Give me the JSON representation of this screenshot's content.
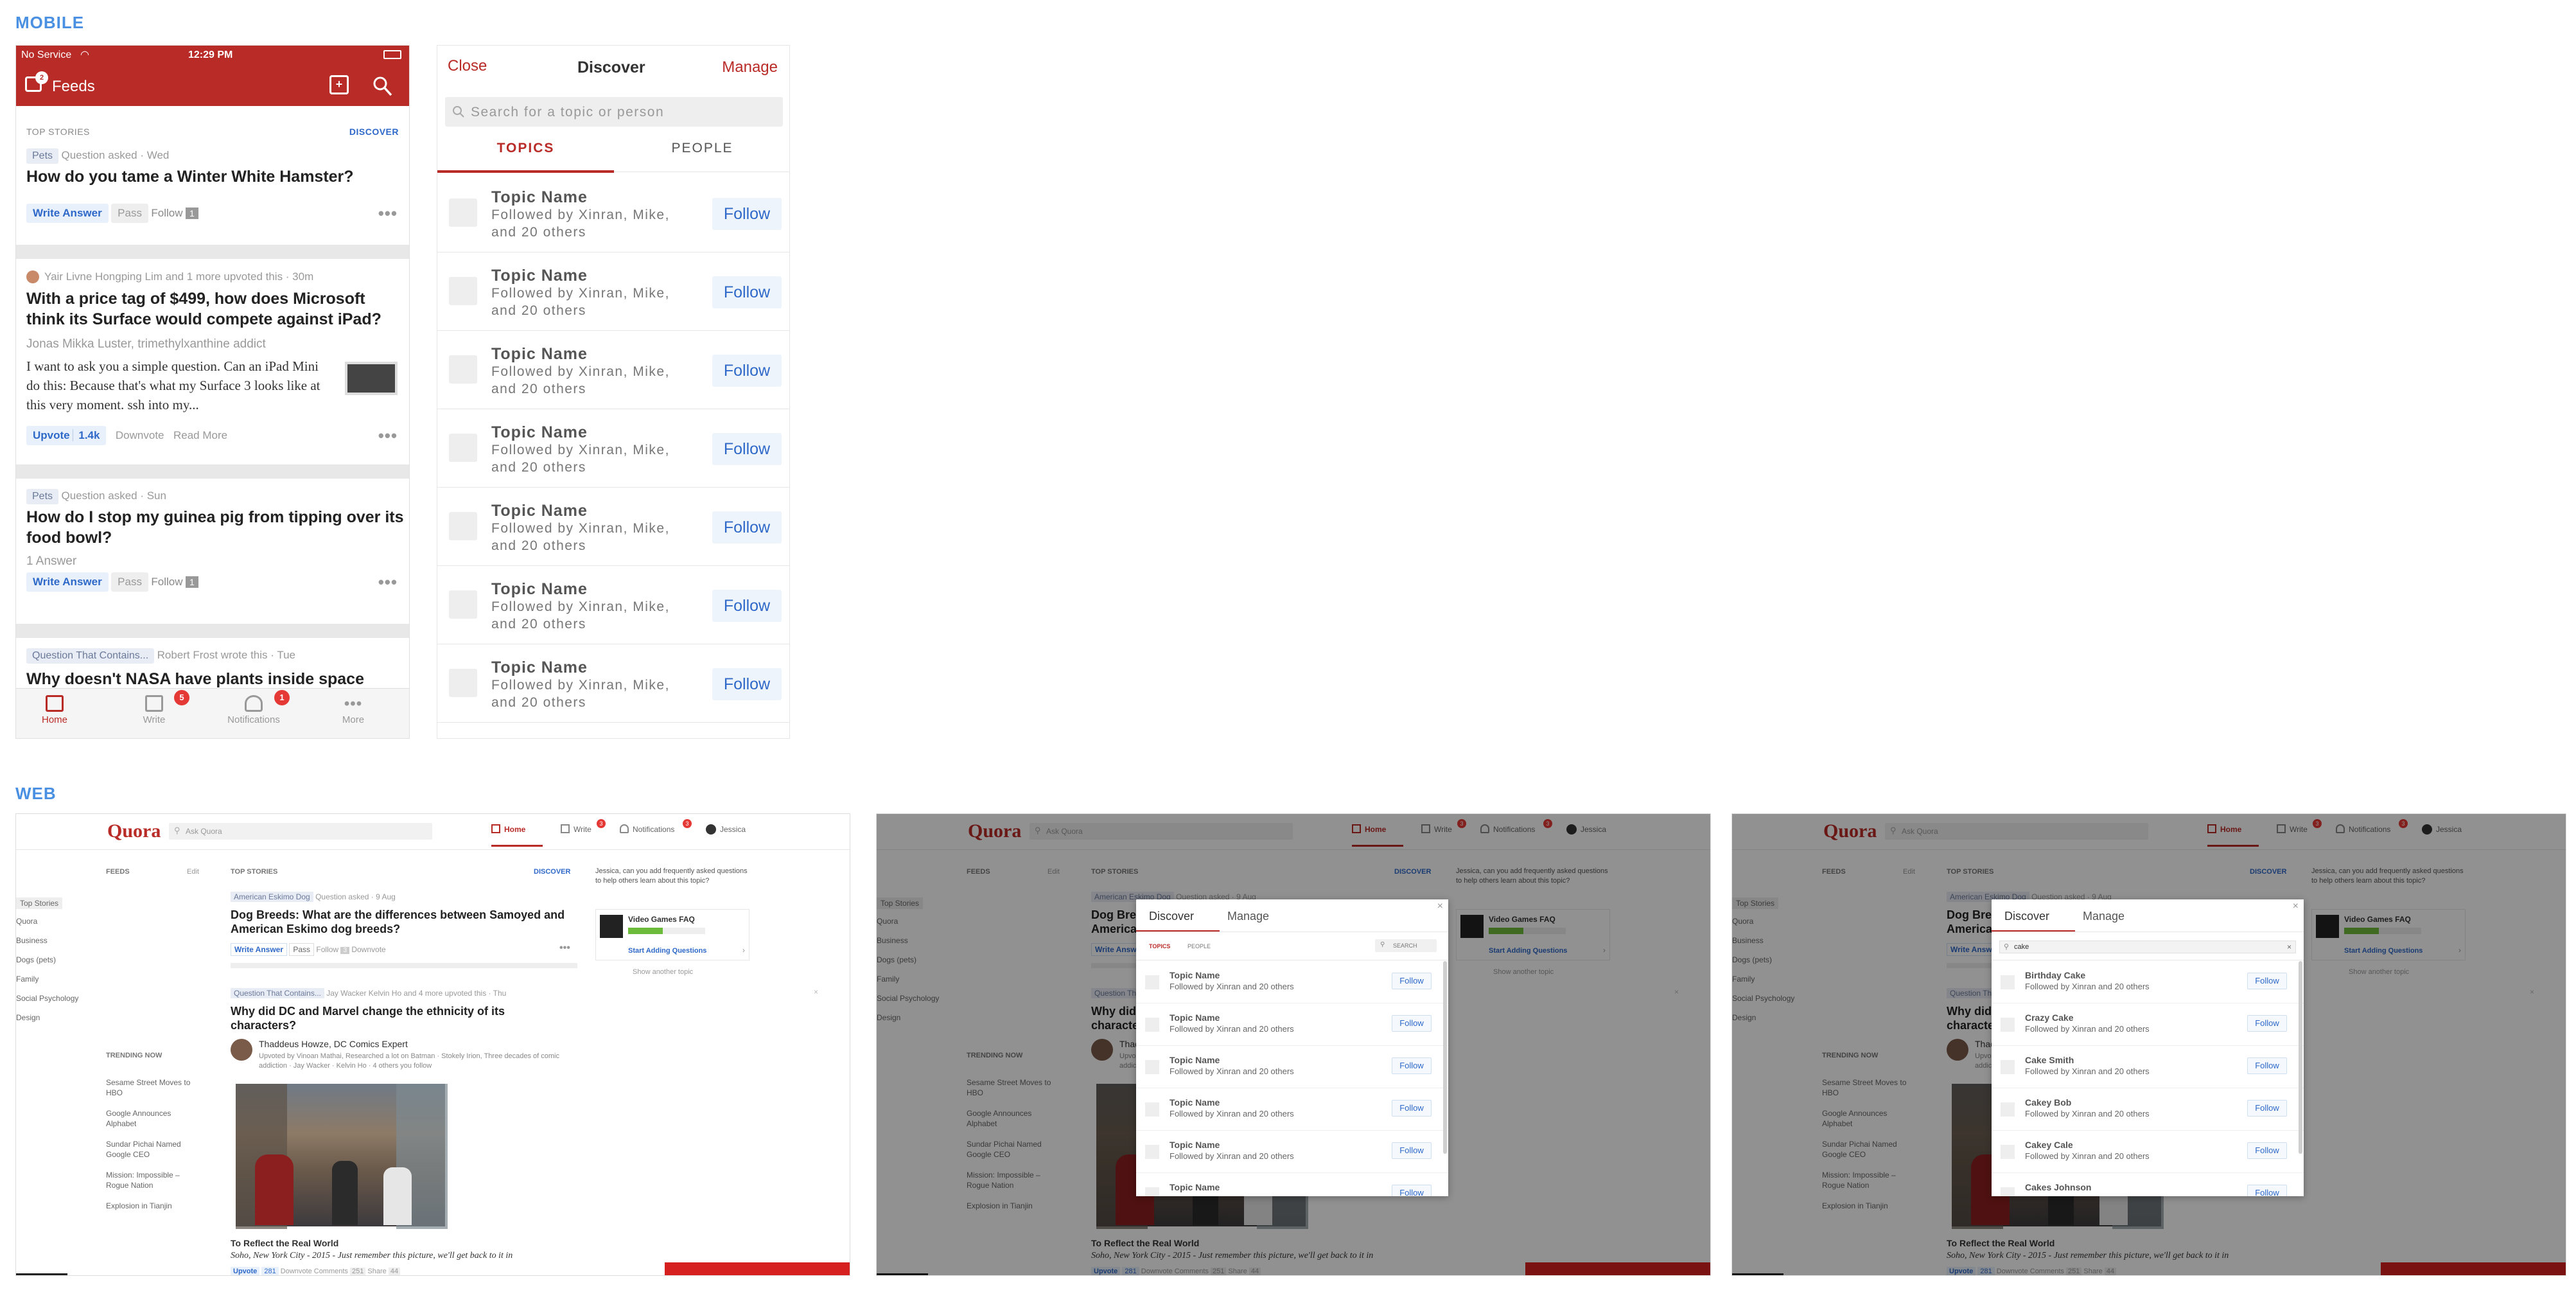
{
  "sections": {
    "mobile": "MOBILE",
    "web": "WEB"
  },
  "colors": {
    "brand_red": "#b92b27",
    "link_blue": "#2e69c9",
    "accent_blue": "#4a90e2"
  },
  "mobile": {
    "status": {
      "carrier": "No Service",
      "time": "12:29 PM"
    },
    "header": {
      "title": "Feeds",
      "feeds_badge": "2"
    },
    "top_stories": {
      "label": "TOP STORIES",
      "discover": "DISCOVER"
    },
    "cards": [
      {
        "tag": "Pets",
        "meta": "Question asked · Wed",
        "title": "How do you tame a Winter White Hamster?",
        "action": "Write Answer",
        "pass": "Pass",
        "follow": "Follow",
        "count": "1"
      },
      {
        "meta": "Yair Livne  Hongping Lim and 1 more upvoted this · 30m",
        "title": "With a price tag of $499, how does Microsoft think its Surface would compete against iPad?",
        "author": "Jonas Mikka Luster, trimethylxanthine addict",
        "body": "I want to ask you a simple question. Can an iPad Mini do this: Because that's what my Surface 3 looks like at this very moment. ssh into my...",
        "upvote": "Upvote",
        "upvote_count": "1.4k",
        "downvote": "Downvote",
        "read_more": "Read More"
      },
      {
        "tag": "Pets",
        "meta": "Question asked · Sun",
        "title": "How do I stop my guinea pig from tipping over its food bowl?",
        "answers": "1 Answer",
        "action": "Write Answer",
        "pass": "Pass",
        "follow": "Follow",
        "count": "1"
      },
      {
        "tag": "Question That Contains...",
        "meta": "Robert Frost wrote this · Tue",
        "title": "Why doesn't NASA have plants inside space"
      }
    ],
    "tabbar": [
      {
        "label": "Home",
        "badge": ""
      },
      {
        "label": "Write",
        "badge": "5"
      },
      {
        "label": "Notifications",
        "badge": "1"
      },
      {
        "label": "More",
        "badge": ""
      }
    ],
    "discover": {
      "close": "Close",
      "title": "Discover",
      "manage": "Manage",
      "search_placeholder": "Search for a topic or person",
      "tabs": [
        "TOPICS",
        "PEOPLE"
      ],
      "rows": [
        {
          "name": "Topic Name",
          "sub": "Followed by Xinran, Mike, and 20 others",
          "button": "Follow"
        },
        {
          "name": "Topic Name",
          "sub": "Followed by Xinran, Mike, and 20 others",
          "button": "Follow"
        },
        {
          "name": "Topic Name",
          "sub": "Followed by Xinran, Mike, and 20 others",
          "button": "Follow"
        },
        {
          "name": "Topic Name",
          "sub": "Followed by Xinran, Mike, and 20 others",
          "button": "Follow"
        },
        {
          "name": "Topic Name",
          "sub": "Followed by Xinran, Mike, and 20 others",
          "button": "Follow"
        },
        {
          "name": "Topic Name",
          "sub": "Followed by Xinran, Mike, and 20 others",
          "button": "Follow"
        },
        {
          "name": "Topic Name",
          "sub": "Followed by Xinran, Mike, and 20 others",
          "button": "Follow"
        }
      ]
    }
  },
  "web": {
    "logo": "Quora",
    "search_placeholder": "Ask Quora",
    "nav": {
      "home": "Home",
      "write": "Write",
      "write_badge": "3",
      "notifications": "Notifications",
      "notif_badge": "3",
      "user": "Jessica"
    },
    "sidebar": {
      "feeds_label": "FEEDS",
      "edit": "Edit",
      "items": [
        "Top Stories",
        "Quora",
        "Business",
        "Dogs (pets)",
        "Family",
        "Social Psychology",
        "Design"
      ],
      "trending_label": "TRENDING NOW",
      "trending": [
        "Sesame Street Moves to HBO",
        "Google Announces Alphabet",
        "Sundar Pichai Named Google CEO",
        "Mission: Impossible – Rogue Nation",
        "Explosion in Tianjin"
      ]
    },
    "feed": {
      "top_stories": "TOP STORIES",
      "discover": "DISCOVER",
      "q1_tag": "American Eskimo Dog",
      "q1_meta": "Question asked · 9 Aug",
      "q1_title": "Dog Breeds: What are the differences between Samoyed and American Eskimo dog breeds?",
      "q1_write": "Write Answer",
      "q1_pass": "Pass",
      "q1_follow": "Follow",
      "q1_count": "3",
      "q1_downvote": "Downvote",
      "q2_tag": "Question That Contains...",
      "q2_meta": "Jay Wacker  Kelvin Ho and 4 more upvoted this · Thu",
      "q2_title": "Why did DC and Marvel change the ethnicity of its characters?",
      "q2_author": "Thaddeus Howze, DC Comics Expert",
      "q2_cred": "Upvoted by Vinoan Mathai, Researched a lot on Batman · Stokely Irion, Three decades of comic addiction · Jay Wacker · Kelvin Ho · 4 others you follow",
      "photo_title": "To Reflect the Real World",
      "photo_caption": "Soho, New York City - 2015 - Just remember this picture, we'll get back to it in",
      "upvote": "Upvote",
      "upvote_count": "281",
      "downvote": "Downvote",
      "comments": "Comments",
      "comments_count": "251",
      "share": "Share",
      "share_count": "44"
    },
    "right": {
      "prompt": "Jessica, can you add frequently asked questions to help others learn about this topic?",
      "faq": "Video Games FAQ",
      "start": "Start Adding Questions",
      "another": "Show another topic"
    },
    "modal": {
      "discover": "Discover",
      "manage": "Manage",
      "tabs": [
        "TOPICS",
        "PEOPLE"
      ],
      "search": "SEARCH",
      "query": "cake",
      "topic_rows": [
        {
          "name": "Topic Name",
          "sub": "Followed by Xinran and 20 others",
          "button": "Follow"
        },
        {
          "name": "Topic Name",
          "sub": "Followed by Xinran and 20 others",
          "button": "Follow"
        },
        {
          "name": "Topic Name",
          "sub": "Followed by Xinran and 20 others",
          "button": "Follow"
        },
        {
          "name": "Topic Name",
          "sub": "Followed by Xinran and 20 others",
          "button": "Follow"
        },
        {
          "name": "Topic Name",
          "sub": "Followed by Xinran and 20 others",
          "button": "Follow"
        },
        {
          "name": "Topic Name",
          "sub": "",
          "button": "Follow"
        }
      ],
      "result_rows": [
        {
          "name": "Birthday Cake",
          "sub": "Followed by Xinran and 20 others",
          "button": "Follow"
        },
        {
          "name": "Crazy Cake",
          "sub": "Followed by Xinran and 20 others",
          "button": "Follow"
        },
        {
          "name": "Cake Smith",
          "sub": "Followed by Xinran and 20 others",
          "button": "Follow"
        },
        {
          "name": "Cakey Bob",
          "sub": "Followed by Xinran and 20 others",
          "button": "Follow"
        },
        {
          "name": "Cakey Cale",
          "sub": "Followed by Xinran and 20 others",
          "button": "Follow"
        },
        {
          "name": "Cakes Johnson",
          "sub": "",
          "button": "Follow"
        }
      ]
    }
  }
}
